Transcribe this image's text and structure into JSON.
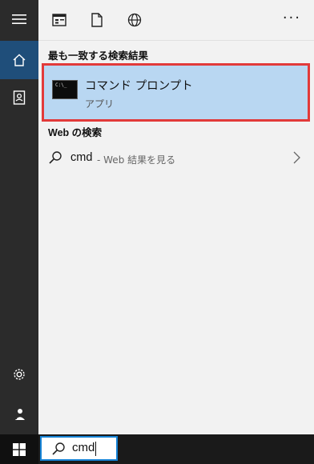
{
  "toolbar": {
    "icons": [
      "app-list-icon",
      "document-icon",
      "globe-icon"
    ],
    "more_label": "···"
  },
  "rail": {
    "items": [
      "hamburger-icon",
      "home-icon",
      "contact-book-icon",
      "settings-icon",
      "user-icon"
    ],
    "active": "home-icon"
  },
  "best_match": {
    "heading": "最も一致する検索結果",
    "title": "コマンド プロンプト",
    "subtitle": "アプリ",
    "icon_text": "C:\\_"
  },
  "web_search": {
    "heading": "Web の検索",
    "query": "cmd",
    "hint": "- Web 結果を見る"
  },
  "taskbar": {
    "search_value": "cmd",
    "start_icon": "windows-logo-icon"
  },
  "colors": {
    "rail": "#2b2b2b",
    "rail_active": "#1f4e7a",
    "highlight": "#b9d7f2",
    "highlight_border": "#e23a3a",
    "search_border": "#1583d6"
  }
}
